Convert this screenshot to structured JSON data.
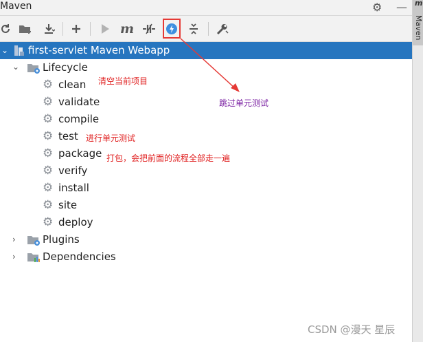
{
  "window": {
    "title": "Maven"
  },
  "toolbar": {
    "buttons": [
      {
        "icon": "reload-icon"
      },
      {
        "icon": "add-maven-projects-icon"
      },
      {
        "icon": "download-sources-icon"
      },
      {
        "icon": "add-icon"
      },
      {
        "icon": "run-icon"
      },
      {
        "icon": "execute-goal-icon"
      },
      {
        "icon": "toggle-offline-icon"
      },
      {
        "icon": "skip-tests-icon"
      },
      {
        "icon": "collapse-all-icon"
      },
      {
        "icon": "settings-wrench-icon"
      }
    ],
    "highlight_color": "#e53935"
  },
  "side_tab": {
    "letter": "m",
    "label": "Maven"
  },
  "tree": {
    "root": {
      "label": "first-servlet Maven Webapp"
    },
    "lifecycle": {
      "label": "Lifecycle",
      "items": [
        "clean",
        "validate",
        "compile",
        "test",
        "package",
        "verify",
        "install",
        "site",
        "deploy"
      ]
    },
    "plugins": {
      "label": "Plugins"
    },
    "dependencies": {
      "label": "Dependencies"
    }
  },
  "annotations": {
    "clean": "清空当前项目",
    "skip_tests": "跳过单元测试",
    "test": "进行单元测试",
    "package": "打包，会把前面的流程全部走一遍"
  },
  "watermark": "CSDN @漫天 星辰",
  "colors": {
    "selection": "#2675bf",
    "note": "#e02020",
    "note_purple": "#7a1fa2"
  }
}
